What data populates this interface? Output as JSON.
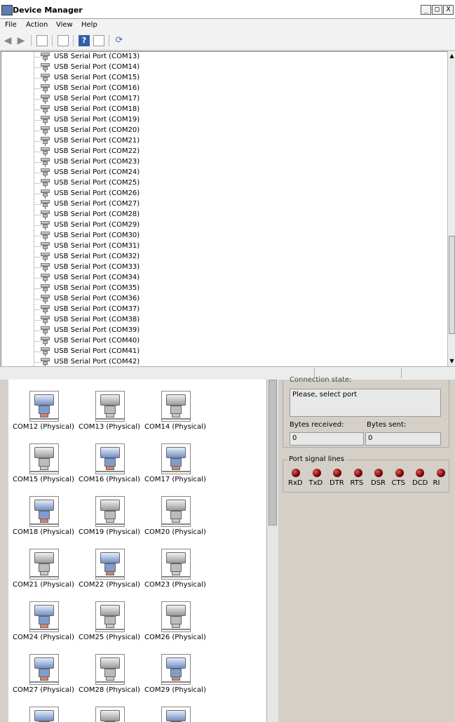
{
  "window": {
    "title": "Device Manager",
    "controls": [
      "_",
      "□",
      "X"
    ]
  },
  "menu": [
    "File",
    "Action",
    "View",
    "Help"
  ],
  "toolbar": {
    "help": "?"
  },
  "tree": {
    "items": [
      "USB Serial Port (COM13)",
      "USB Serial Port (COM14)",
      "USB Serial Port (COM15)",
      "USB Serial Port (COM16)",
      "USB Serial Port (COM17)",
      "USB Serial Port (COM18)",
      "USB Serial Port (COM19)",
      "USB Serial Port (COM20)",
      "USB Serial Port (COM21)",
      "USB Serial Port (COM22)",
      "USB Serial Port (COM23)",
      "USB Serial Port (COM24)",
      "USB Serial Port (COM25)",
      "USB Serial Port (COM26)",
      "USB Serial Port (COM27)",
      "USB Serial Port (COM28)",
      "USB Serial Port (COM29)",
      "USB Serial Port (COM30)",
      "USB Serial Port (COM31)",
      "USB Serial Port (COM32)",
      "USB Serial Port (COM33)",
      "USB Serial Port (COM34)",
      "USB Serial Port (COM35)",
      "USB Serial Port (COM36)",
      "USB Serial Port (COM37)",
      "USB Serial Port (COM38)",
      "USB Serial Port (COM39)",
      "USB Serial Port (COM40)",
      "USB Serial Port (COM41)",
      "USB Serial Port (COM42)"
    ]
  },
  "ports": [
    {
      "label": "COM12 (Physical)",
      "active": true
    },
    {
      "label": "COM13 (Physical)",
      "active": false
    },
    {
      "label": "COM14 (Physical)",
      "active": false
    },
    {
      "label": "COM15 (Physical)",
      "active": false
    },
    {
      "label": "COM16 (Physical)",
      "active": true
    },
    {
      "label": "COM17 (Physical)",
      "active": true
    },
    {
      "label": "COM18 (Physical)",
      "active": true
    },
    {
      "label": "COM19 (Physical)",
      "active": false
    },
    {
      "label": "COM20 (Physical)",
      "active": false
    },
    {
      "label": "COM21 (Physical)",
      "active": false
    },
    {
      "label": "COM22 (Physical)",
      "active": true
    },
    {
      "label": "COM23 (Physical)",
      "active": false
    },
    {
      "label": "COM24 (Physical)",
      "active": true
    },
    {
      "label": "COM25 (Physical)",
      "active": false
    },
    {
      "label": "COM26 (Physical)",
      "active": false
    },
    {
      "label": "COM27 (Physical)",
      "active": true
    },
    {
      "label": "COM28 (Physical)",
      "active": false
    },
    {
      "label": "COM29 (Physical)",
      "active": true
    }
  ],
  "connection": {
    "state_label": "Connection state:",
    "state_value": "Please, select port",
    "bytes_received_label": "Bytes received:",
    "bytes_received": "0",
    "bytes_sent_label": "Bytes sent:",
    "bytes_sent": "0"
  },
  "signals": {
    "title": "Port signal lines",
    "lines": [
      "RxD",
      "TxD",
      "DTR",
      "RTS",
      "DSR",
      "CTS",
      "DCD",
      "RI"
    ],
    "led_color": "#8b0000"
  }
}
